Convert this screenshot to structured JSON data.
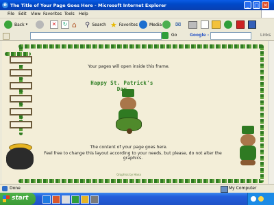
{
  "window": {
    "title": "The Title of Your Page Goes Here - Microsoft Internet Explorer",
    "ie_glyph": "e",
    "min_glyph": "_",
    "max_glyph": "□",
    "close_glyph": "✕"
  },
  "menu": [
    "File",
    "Edit",
    "View",
    "Favorites",
    "Tools",
    "Help"
  ],
  "toolbar": {
    "back": "Back",
    "search": "Search",
    "favorites": "Favorites",
    "media": "Media"
  },
  "addressbar": {
    "go": "Go",
    "links": "Links",
    "google": "Google -"
  },
  "page": {
    "frame_text": "Your pages will open inside this frame.",
    "heading": "Happy St. Patrick's Day",
    "content_line1": "The content of your page goes here.",
    "content_line2": "Feel free to change this layout according to your needs, but please, do not alter the graphics.",
    "credit": "Graphics by Hana"
  },
  "status": {
    "left": "Done",
    "zone": "My Computer"
  },
  "taskbar": {
    "start": "start"
  },
  "colors": {
    "vine": "#2f7a22",
    "leaf_light": "#5da33b",
    "page_bg": "#f3eed8",
    "heading": "#2e7d22",
    "xp_blue": "#0049c8"
  }
}
